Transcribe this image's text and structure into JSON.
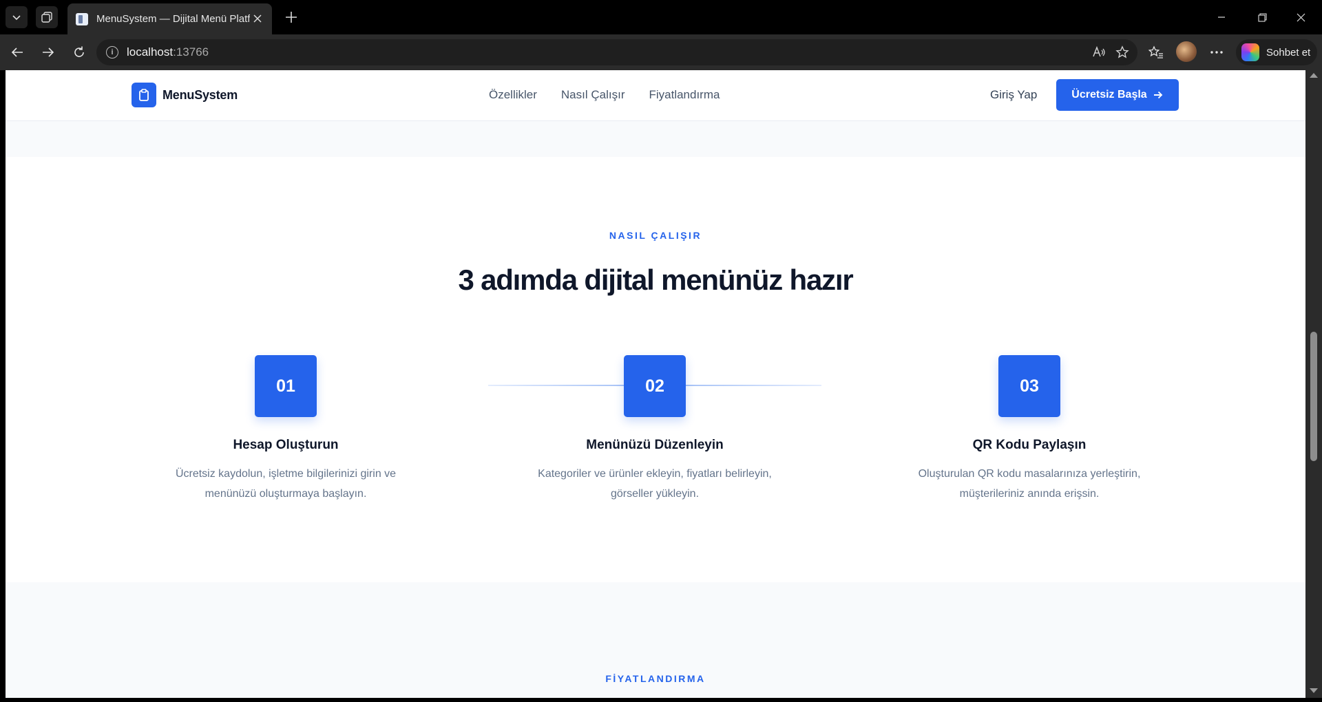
{
  "browser": {
    "tab_title": "MenuSystem — Dijital Menü Platformu",
    "url_host": "localhost",
    "url_port": ":13766",
    "copilot_label": "Sohbet et",
    "icons": {
      "tab_actions": "chevron-down-icon",
      "workspaces": "workspaces-icon",
      "new_tab": "plus-icon",
      "back": "arrow-left-icon",
      "forward": "arrow-right-icon",
      "refresh": "refresh-icon",
      "site_info": "info-icon",
      "read_aloud": "read-aloud-icon",
      "favorite": "star-icon",
      "favorites": "favorites-list-icon",
      "more": "more-icon"
    }
  },
  "site": {
    "brand": "MenuSystem",
    "nav": [
      {
        "label": "Özellikler"
      },
      {
        "label": "Nasıl Çalışır"
      },
      {
        "label": "Fiyatlandırma"
      }
    ],
    "login": "Giriş Yap",
    "cta": "Ücretsiz Başla",
    "accent_color": "#2563eb"
  },
  "how_it_works": {
    "eyebrow": "NASIL ÇALIŞIR",
    "title": "3 adımda dijital menünüz hazır",
    "steps": [
      {
        "number": "01",
        "title": "Hesap Oluşturun",
        "desc_line1": "Ücretsiz kaydolun, işletme bilgilerinizi girin ve",
        "desc_line2": "menünüzü oluşturmaya başlayın."
      },
      {
        "number": "02",
        "title": "Menünüzü Düzenleyin",
        "desc_line1": "Kategoriler ve ürünler ekleyin, fiyatları belirleyin,",
        "desc_line2": "görseller yükleyin."
      },
      {
        "number": "03",
        "title": "QR Kodu Paylaşın",
        "desc_line1": "Oluşturulan QR kodu masalarınıza yerleştirin,",
        "desc_line2": "müşterileriniz anında erişsin."
      }
    ]
  },
  "pricing": {
    "eyebrow": "FİYATLANDIRMA"
  }
}
